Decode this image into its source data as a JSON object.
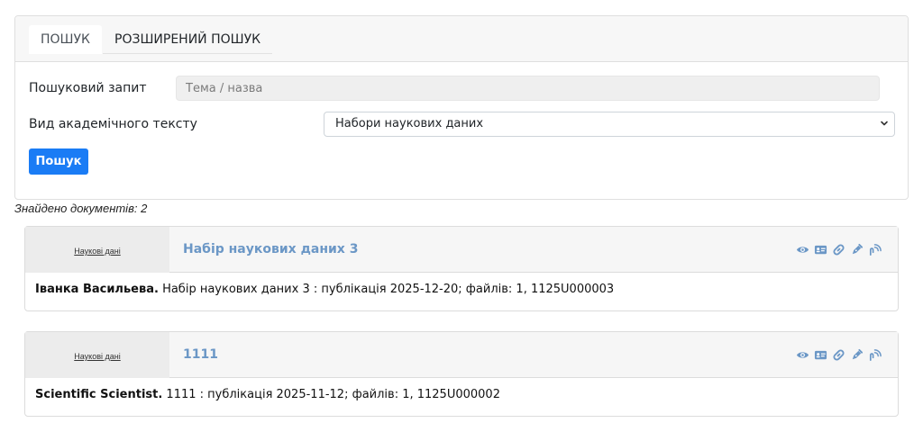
{
  "tabs": [
    {
      "label": "ПОШУК",
      "active": true
    },
    {
      "label": "РОЗШИРЕНИЙ ПОШУК",
      "active": false
    }
  ],
  "form": {
    "query_label": "Пошуковий запит",
    "query_placeholder": "Тема / назва",
    "query_value": "",
    "type_label": "Вид академічного тексту",
    "type_selected": "Набори наукових даних",
    "search_button": "Пошук"
  },
  "found_count": "Знайдено документів: 2",
  "results": [
    {
      "type": "Наукові дані",
      "title": "Набір наукових даних 3",
      "author": "Іванка Васильева.",
      "citation": " Набір наукових даних 3 : публікація 2025-12-20; файлів: 1, 1125U000003"
    },
    {
      "type": "Наукові дані",
      "title": "1111",
      "author": "Scientific Scientist.",
      "citation": " 1111 : публікація 2025-11-12; файлів: 1, 1125U000002"
    }
  ],
  "icons": [
    "eye-icon",
    "id-card-icon",
    "link-icon",
    "pen-icon",
    "rss-hand-icon"
  ],
  "colors": {
    "accent_button": "#1a7cf5",
    "title_link": "#6b97c6",
    "icon": "#6b97c6"
  }
}
